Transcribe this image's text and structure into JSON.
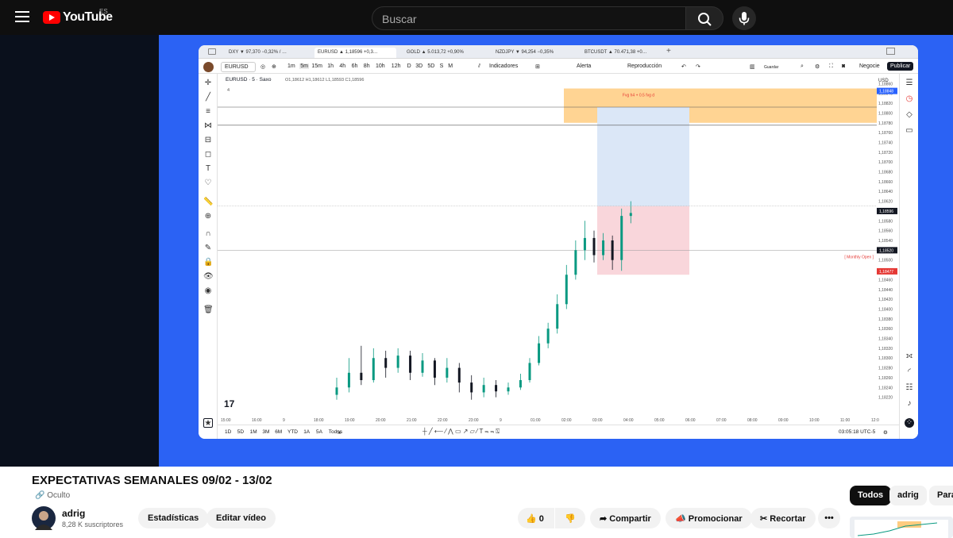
{
  "header": {
    "logo_text": "YouTube",
    "region": "ES",
    "search_placeholder": "Buscar"
  },
  "tradingview": {
    "tabs": [
      {
        "symbol": "DXY",
        "text": "DXY ▼ 97,370 −0,32% / …",
        "color": "#d32f2f"
      },
      {
        "symbol": "EURUSD",
        "text": "EURUSD ▲ 1,18596 +0,3…",
        "color": "#089981"
      },
      {
        "symbol": "GOLD",
        "text": "GOLD ▲ 5.013,72 +0,90%",
        "color": "#089981"
      },
      {
        "symbol": "NZDJPY",
        "text": "NZDJPY ▼ 94,254 −0,35%",
        "color": "#d32f2f"
      },
      {
        "symbol": "BTCUSDT",
        "text": "BTCUSDT ▲ 70.471,38 +0…",
        "color": "#089981"
      }
    ],
    "toolbar": {
      "symbol": "EURUSD",
      "timeframes": [
        "1m",
        "5m",
        "15m",
        "1h",
        "4h",
        "6h",
        "8h",
        "10h",
        "12h",
        "D",
        "3D",
        "5D",
        "S",
        "M"
      ],
      "indicators": "Indicadores",
      "alert": "Alerta",
      "replay": "Reproducción",
      "save": "Guardar",
      "trade": "Negocie",
      "publish": "Publicar"
    },
    "legend": {
      "symbol_line": "EURUSD · 5 · Saxo",
      "ohlc": "O1,18612 H1,18612 L1,18593 C1,18596",
      "count": "4"
    },
    "annotations": {
      "fvg": "Fvg h4 + 0.5 fvg d",
      "monthly_open": "[ Monthly Open ]"
    },
    "price_scale": [
      "1,18860",
      "1,18840",
      "1,18820",
      "1,18800",
      "1,18780",
      "1,18760",
      "1,18740",
      "1,18720",
      "1,18700",
      "1,18680",
      "1,18660",
      "1,18640",
      "1,18620",
      "1,18600",
      "1,18580",
      "1,18560",
      "1,18540",
      "1,18520",
      "1,18500",
      "1,18480",
      "1,18460",
      "1,18440",
      "1,18420",
      "1,18400",
      "1,18380",
      "1,18360",
      "1,18340",
      "1,18320",
      "1,18300",
      "1,18280",
      "1,18260",
      "1,18240",
      "1,18220"
    ],
    "price_tags": {
      "top": "1,18848",
      "current": "1,18596",
      "monthly": "1,18520",
      "bottom": "1,18477"
    },
    "currency": "USD",
    "time_axis": [
      "15:00",
      "16:00",
      "9",
      "18:00",
      "19:00",
      "20:00",
      "21:00",
      "22:00",
      "23:00",
      "9",
      "01:00",
      "02:00",
      "03:00",
      "04:00",
      "05:00",
      "06:00",
      "07:00",
      "08:00",
      "09:00",
      "10:00",
      "11:00",
      "12:0"
    ],
    "ranges": [
      "1D",
      "5D",
      "1M",
      "3M",
      "6M",
      "YTD",
      "1A",
      "5A",
      "Todos"
    ],
    "clock": "03:05:18 UTC-5",
    "candles": [
      {
        "t": 0,
        "o": 1.18225,
        "c": 1.1824,
        "h": 1.1826,
        "l": 1.18215
      },
      {
        "t": 1,
        "o": 1.1824,
        "c": 1.1827,
        "h": 1.183,
        "l": 1.1823
      },
      {
        "t": 2,
        "o": 1.1827,
        "c": 1.18255,
        "h": 1.18325,
        "l": 1.18245
      },
      {
        "t": 3,
        "o": 1.18255,
        "c": 1.183,
        "h": 1.1832,
        "l": 1.1825
      },
      {
        "t": 4,
        "o": 1.183,
        "c": 1.1828,
        "h": 1.18315,
        "l": 1.1826
      },
      {
        "t": 5,
        "o": 1.1828,
        "c": 1.18305,
        "h": 1.1832,
        "l": 1.1827
      },
      {
        "t": 6,
        "o": 1.18305,
        "c": 1.1827,
        "h": 1.18315,
        "l": 1.18255
      },
      {
        "t": 7,
        "o": 1.1827,
        "c": 1.18295,
        "h": 1.1831,
        "l": 1.18262
      },
      {
        "t": 8,
        "o": 1.18295,
        "c": 1.1826,
        "h": 1.183,
        "l": 1.18245
      },
      {
        "t": 9,
        "o": 1.1826,
        "c": 1.1828,
        "h": 1.183,
        "l": 1.1825
      },
      {
        "t": 10,
        "o": 1.1828,
        "c": 1.1825,
        "h": 1.1829,
        "l": 1.1823
      },
      {
        "t": 11,
        "o": 1.1825,
        "c": 1.1823,
        "h": 1.18265,
        "l": 1.18215
      },
      {
        "t": 12,
        "o": 1.1823,
        "c": 1.18245,
        "h": 1.1826,
        "l": 1.1822
      },
      {
        "t": 13,
        "o": 1.18245,
        "c": 1.18232,
        "h": 1.18255,
        "l": 1.1822
      },
      {
        "t": 14,
        "o": 1.18232,
        "c": 1.1824,
        "h": 1.1825,
        "l": 1.18225
      },
      {
        "t": 15,
        "o": 1.1824,
        "c": 1.18255,
        "h": 1.18268,
        "l": 1.18235
      },
      {
        "t": 16,
        "o": 1.18255,
        "c": 1.1829,
        "h": 1.183,
        "l": 1.1825
      },
      {
        "t": 17,
        "o": 1.1829,
        "c": 1.1833,
        "h": 1.18345,
        "l": 1.18285
      },
      {
        "t": 18,
        "o": 1.1833,
        "c": 1.1836,
        "h": 1.18372,
        "l": 1.1832
      },
      {
        "t": 19,
        "o": 1.1836,
        "c": 1.1841,
        "h": 1.1843,
        "l": 1.1835
      },
      {
        "t": 20,
        "o": 1.1841,
        "c": 1.1847,
        "h": 1.1849,
        "l": 1.184
      },
      {
        "t": 21,
        "o": 1.1847,
        "c": 1.1852,
        "h": 1.1854,
        "l": 1.1846
      },
      {
        "t": 22,
        "o": 1.1852,
        "c": 1.18545,
        "h": 1.1858,
        "l": 1.185
      },
      {
        "t": 23,
        "o": 1.18545,
        "c": 1.1851,
        "h": 1.1856,
        "l": 1.18495
      },
      {
        "t": 24,
        "o": 1.1851,
        "c": 1.1854,
        "h": 1.18555,
        "l": 1.185
      },
      {
        "t": 25,
        "o": 1.1854,
        "c": 1.185,
        "h": 1.1855,
        "l": 1.1848
      },
      {
        "t": 26,
        "o": 1.185,
        "c": 1.1859,
        "h": 1.18605,
        "l": 1.18478
      },
      {
        "t": 27,
        "o": 1.1859,
        "c": 1.18596,
        "h": 1.1862,
        "l": 1.18575
      }
    ]
  },
  "video": {
    "title": "EXPECTATIVAS SEMANALES 09/02 - 13/02",
    "visibility": "Oculto",
    "channel": "adrig",
    "subscribers": "8,28 K suscriptores",
    "buttons": {
      "stats": "Estadísticas",
      "edit": "Editar vídeo",
      "likes": "0",
      "share": "Compartir",
      "promote": "Promocionar",
      "clip": "Recortar"
    }
  },
  "chips": [
    "Todos",
    "adrig",
    "Para"
  ],
  "colors": {
    "up": "#089981",
    "down": "#131722",
    "fvg_zone": "#ffcc80",
    "target_zone": "#dbe7f7",
    "stop_zone": "#f9d6db",
    "slide_bg": "#2b62f4",
    "brand": "#ff0000"
  }
}
